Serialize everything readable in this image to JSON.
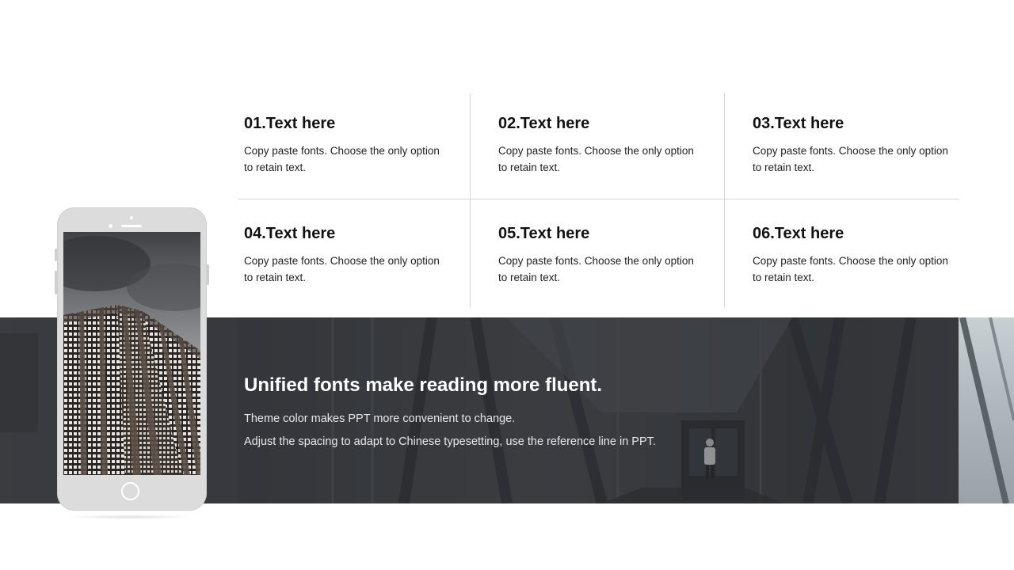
{
  "grid": {
    "items": [
      {
        "title": "01.Text here",
        "text": "Copy paste fonts. Choose the only option to retain text."
      },
      {
        "title": "02.Text here",
        "text": "Copy paste fonts. Choose the only option to retain text."
      },
      {
        "title": "03.Text here",
        "text": "Copy paste fonts. Choose the only option to retain text."
      },
      {
        "title": "04.Text here",
        "text": "Copy paste fonts. Choose the only option to retain text."
      },
      {
        "title": "05.Text here",
        "text": "Copy paste fonts. Choose the only option to retain text."
      },
      {
        "title": "06.Text here",
        "text": "Copy paste fonts. Choose the only option to retain text."
      }
    ]
  },
  "banner": {
    "title": "Unified fonts make reading more fluent.",
    "line1": "Theme color makes PPT more convenient to change.",
    "line2": "Adjust the spacing to adapt to Chinese typesetting, use the reference line in PPT."
  },
  "colors": {
    "band": "#404246",
    "text_dark": "#111111",
    "divider": "#d6d6d6",
    "phone_body": "#dcdcdc"
  },
  "icons": {
    "phone": "smartphone-mockup-icon",
    "home_button": "home-button-icon"
  }
}
